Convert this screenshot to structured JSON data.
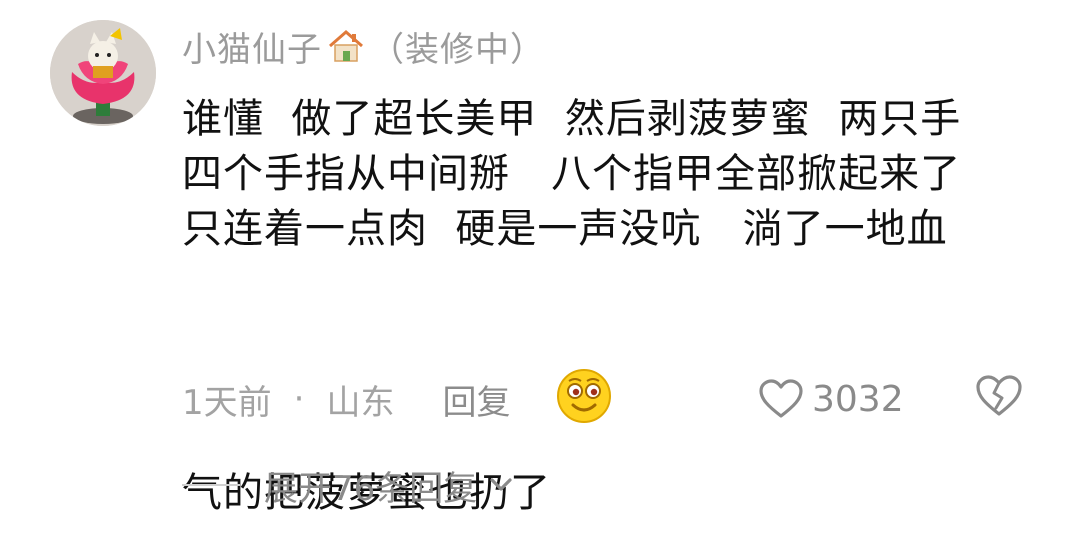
{
  "comment": {
    "username": "小猫仙子",
    "user_badge": "（装修中）",
    "lines": [
      "谁懂  做了超长美甲  然后剥菠萝蜜  两只手",
      "四个手指从中间掰   八个指甲全部掀起来了",
      "只连着一点肉  硬是一声没吭   淌了一地血",
      "气的把菠萝蜜也扔了"
    ],
    "time": "1天前",
    "separator": "·",
    "location": "山东",
    "reply_label": "回复",
    "like_count": "3032",
    "expand_label": "展开76条回复"
  },
  "icons": {
    "username_emoji": "house-icon",
    "inline_emoji": "smiley-emoji",
    "like": "heart-outline-icon",
    "dislike": "broken-heart-icon",
    "expand": "chevron-down-icon"
  },
  "colors": {
    "background": "#ffffff",
    "text_primary": "#111111",
    "text_secondary": "#9b9b9b"
  }
}
